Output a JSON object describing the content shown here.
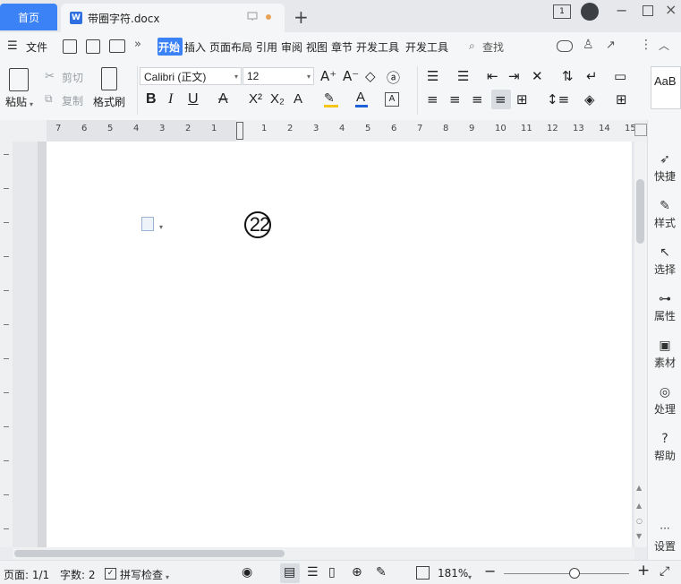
{
  "tabs": {
    "home_label": "首页",
    "doc_title": "带圈字符.docx",
    "doc_icon_letter": "W"
  },
  "window_controls": {
    "badge": "1"
  },
  "menu": {
    "file_label": "文件",
    "items": [
      "开始",
      "插入",
      "页面布局",
      "引用",
      "审阅",
      "视图",
      "章节",
      "开发工具",
      "开发工具"
    ],
    "active_index": 0,
    "search_label": "查找"
  },
  "ribbon": {
    "paste": "粘贴",
    "cut": "剪切",
    "copy": "复制",
    "format_painter": "格式刷",
    "font_name": "Calibri (正文)",
    "font_size": "12",
    "styles_preview": "AaB"
  },
  "ruler": {
    "numbers": [
      "7",
      "6",
      "5",
      "4",
      "3",
      "2",
      "1",
      "1",
      "2",
      "3",
      "4",
      "5",
      "6",
      "7",
      "8",
      "9",
      "10",
      "11",
      "12",
      "13",
      "14",
      "15"
    ]
  },
  "document": {
    "circled_text": "22"
  },
  "sidebar": {
    "items": [
      "快捷",
      "样式",
      "选择",
      "属性",
      "素材",
      "处理",
      "帮助",
      "设置"
    ]
  },
  "status": {
    "page": "页面: 1/1",
    "word_count": "字数: 2",
    "spell_check": "拼写检查",
    "zoom": "181%",
    "zoom_level": 0.56
  },
  "colors": {
    "accent": "#3b82f6",
    "unsaved": "#e8a35a",
    "highlight": "#f5c518",
    "font_color": "#1a62d6"
  }
}
